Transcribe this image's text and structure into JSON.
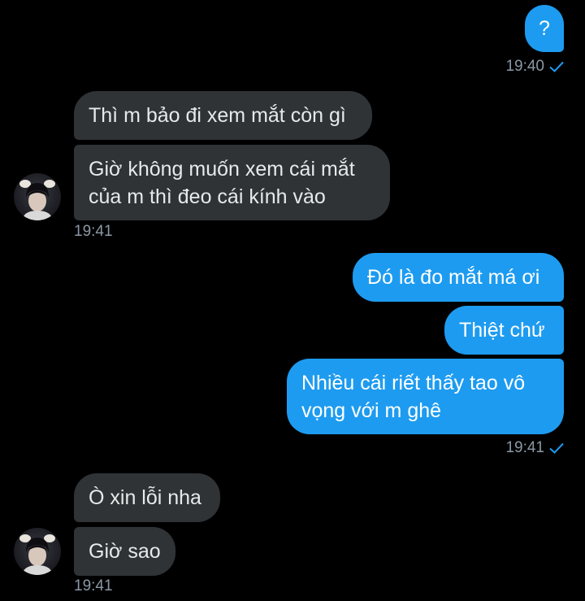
{
  "colors": {
    "background": "#000000",
    "incoming_bubble": "#2f3336",
    "outgoing_bubble": "#1d9bf0",
    "timestamp": "#8b98a5",
    "read_check": "#1d9bf0"
  },
  "messages": [
    {
      "text": "?",
      "dir": "out"
    },
    {
      "text": "Thì m bảo đi xem mắt còn gì",
      "dir": "in"
    },
    {
      "text": "Giờ không muốn xem cái mắt\ncủa m thì đeo cái kính vào",
      "dir": "in"
    },
    {
      "text": "Đó là đo mắt má ơi",
      "dir": "out"
    },
    {
      "text": "Thiệt chứ",
      "dir": "out"
    },
    {
      "text": "Nhiều cái riết thấy tao vô\nvọng với m ghê",
      "dir": "out"
    },
    {
      "text": "Ò xin lỗi nha",
      "dir": "in"
    },
    {
      "text": "Giờ sao",
      "dir": "in"
    }
  ],
  "timestamps": {
    "t1": {
      "time": "19:40",
      "icon": "check-icon"
    },
    "t2": {
      "time": "19:41"
    },
    "t3": {
      "time": "19:41",
      "icon": "check-icon"
    },
    "t4": {
      "time": "19:41"
    }
  },
  "avatars": [
    {
      "icon": "contact-avatar"
    },
    {
      "icon": "contact-avatar"
    }
  ]
}
